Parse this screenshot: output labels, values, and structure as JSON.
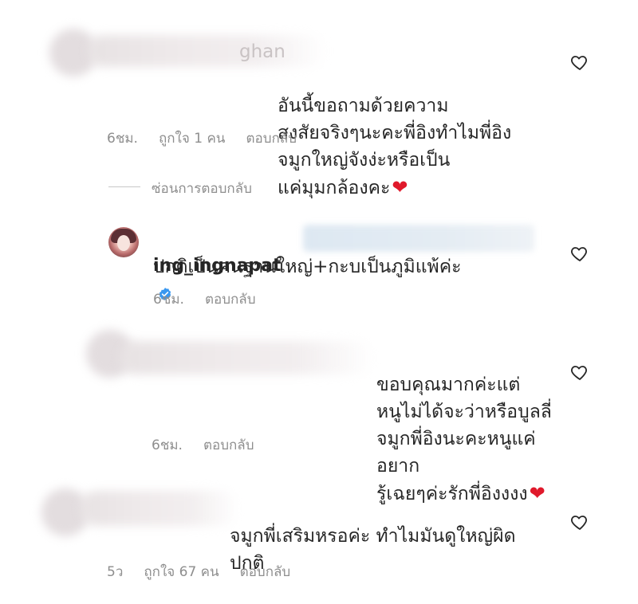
{
  "comments": [
    {
      "username_fragment": "ghan",
      "text": "อันนี้ขอถามด้วยความ\nสงสัยจริงๆนะคะพี่อิงทำไมพี่อิงจมูกใหญ่จังง่ะหรือเป็น\nแค่มุมกล้องคะ",
      "time": "6ชม.",
      "likes": "ถูกใจ 1 คน",
      "reply": "ตอบกลับ"
    },
    {
      "text": "ขอบคุณมากค่ะแต่\nหนูไม่ได้จะว่าหรือบูลลี่จมูกพี่อิงนะคะหนูแค่อยาก\nรู้เฉยๆค่ะรักพี่อิงงงง",
      "time": "6ชม.",
      "reply": "ตอบกลับ"
    },
    {
      "text": "จมูกพี่เสริมหรอค่ะ ทำไมมันดูใหญ่ผิด\nปกติ",
      "time": "5ว",
      "likes": "ถูกใจ 67 คน",
      "reply": "ตอบกลับ"
    }
  ],
  "hide_replies": "ซ่อนการตอบกลับ",
  "reply": {
    "username": "ing_ingnapat",
    "text": "ปกติเป็นคนฐานใหญ่+กะบเป็นภูมิแพ้ค่ะ",
    "time": "6ชม.",
    "reply": "ตอบกลับ"
  },
  "colors": {
    "text": "#262626",
    "meta": "#8e8e8e",
    "verified": "#3897f0",
    "heart_emoji": "#e0192b"
  }
}
